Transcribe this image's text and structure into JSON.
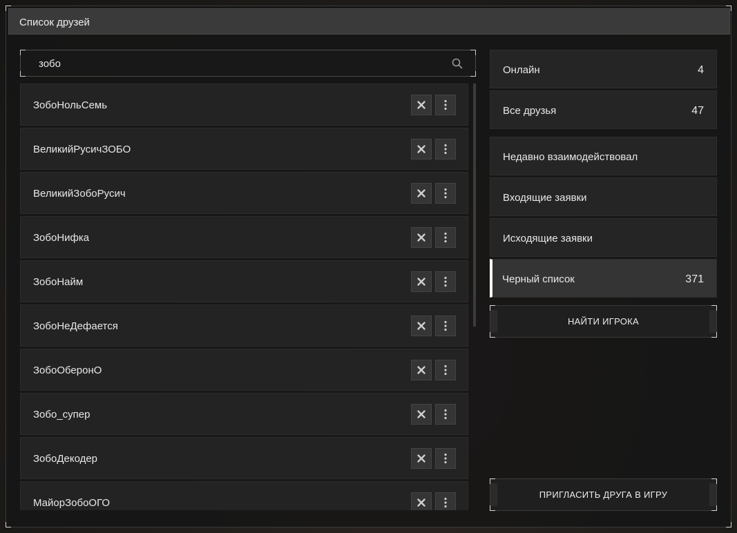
{
  "window": {
    "title": "Список друзей"
  },
  "search": {
    "value": "зобо"
  },
  "friends": [
    {
      "name": "ЗобоНольСемь"
    },
    {
      "name": "ВеликийРусичЗОБО"
    },
    {
      "name": "ВеликийЗобоРусич"
    },
    {
      "name": "ЗобоНифка"
    },
    {
      "name": "ЗобоНайм"
    },
    {
      "name": "ЗобоНеДефается"
    },
    {
      "name": "ЗобоОберонО"
    },
    {
      "name": "Зобо_супер"
    },
    {
      "name": "ЗобоДекодер"
    },
    {
      "name": "МайорЗобоОГО"
    }
  ],
  "nav": {
    "online": {
      "label": "Онлайн",
      "count": "4"
    },
    "all": {
      "label": "Все друзья",
      "count": "47"
    },
    "recent": {
      "label": "Недавно взаимодействовал"
    },
    "incoming": {
      "label": "Входящие заявки"
    },
    "outgoing": {
      "label": "Исходящие заявки"
    },
    "blacklist": {
      "label": "Черный список",
      "count": "371"
    }
  },
  "buttons": {
    "find_player": "НАЙТИ ИГРОКА",
    "invite_friend": "ПРИГЛАСИТЬ ДРУГА В ИГРУ"
  },
  "icons": {
    "search": "search-icon",
    "remove": "close-icon",
    "more": "more-vertical-icon"
  }
}
